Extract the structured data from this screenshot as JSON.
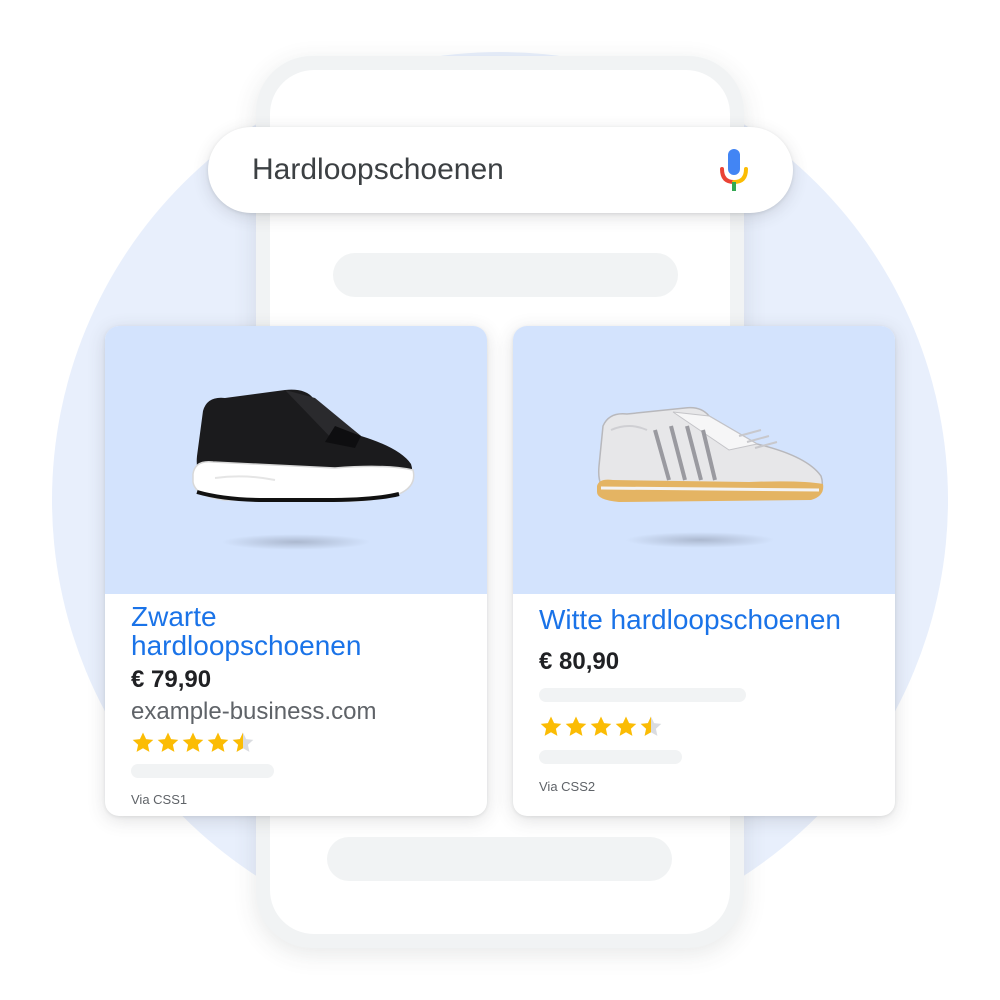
{
  "search": {
    "query": "Hardloopschoenen",
    "mic_icon": "microphone-icon"
  },
  "colors": {
    "link_blue": "#1a73e8",
    "star_gold": "#fbbc04",
    "image_bg": "#d3e3fd",
    "circle_bg": "#e8effc"
  },
  "products": [
    {
      "title": "Zwarte hardloopschoenen",
      "title_line1": "Zwarte",
      "title_line2": "hardloopschoenen",
      "price": "€ 79,90",
      "domain": "example-business.com",
      "rating": 4.5,
      "via": "Via CSS1"
    },
    {
      "title": "Witte hardloopschoenen",
      "price": "€ 80,90",
      "rating": 4.5,
      "via": "Via CSS2"
    }
  ]
}
